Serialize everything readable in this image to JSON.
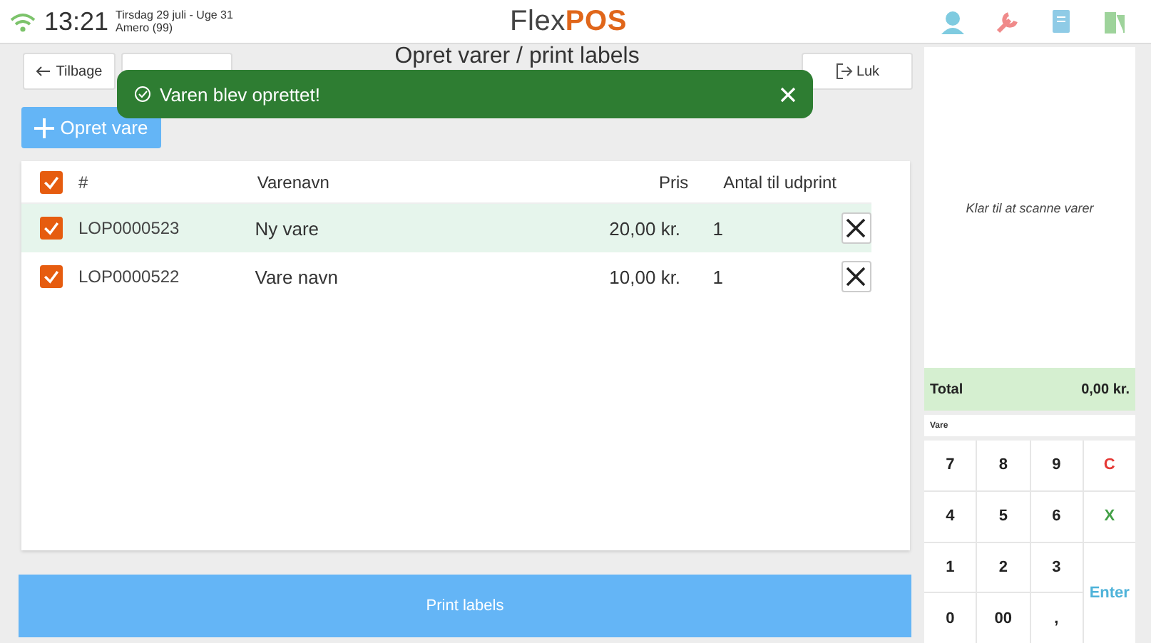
{
  "status_bar": {
    "time": "13:21",
    "date": "Tirsdag 29 juli - Uge 31",
    "user": "Amero (99)",
    "logo": {
      "light": "Flex",
      "bold": "POS"
    }
  },
  "toolbar": {
    "back": "Tilbage",
    "title": "Opret varer / print labels",
    "close": "Luk"
  },
  "toast": {
    "message": "Varen blev oprettet!"
  },
  "create_button": "Opret vare",
  "table": {
    "all_checked": true,
    "columns": [
      "#",
      "Varenavn",
      "Pris",
      "Antal til udprint"
    ],
    "rows": [
      {
        "number": "LOP0000523",
        "name": "Ny vare",
        "price": "20,00 kr.",
        "count": "1",
        "checked": true,
        "highlighted": true
      },
      {
        "number": "LOP0000522",
        "name": "Vare navn",
        "price": "10,00 kr.",
        "count": "1",
        "checked": true,
        "highlighted": false
      }
    ]
  },
  "print_button": "Print labels",
  "side_panel": {
    "message": "Klar til at scanne varer",
    "total_label": "Total",
    "total_value": "0,00 kr.",
    "input_label": "Vare",
    "keys": [
      {
        "label": "7",
        "kind": "digit"
      },
      {
        "label": "8",
        "kind": "digit"
      },
      {
        "label": "9",
        "kind": "digit"
      },
      {
        "label": "C",
        "kind": "clear"
      },
      {
        "label": "4",
        "kind": "digit"
      },
      {
        "label": "5",
        "kind": "digit"
      },
      {
        "label": "6",
        "kind": "digit"
      },
      {
        "label": "X",
        "kind": "cancel"
      },
      {
        "label": "1",
        "kind": "digit"
      },
      {
        "label": "2",
        "kind": "digit"
      },
      {
        "label": "3",
        "kind": "digit"
      },
      {
        "label": "Enter",
        "kind": "enter"
      },
      {
        "label": "0",
        "kind": "digit"
      },
      {
        "label": "00",
        "kind": "digit"
      },
      {
        "label": ",",
        "kind": "digit"
      }
    ]
  }
}
